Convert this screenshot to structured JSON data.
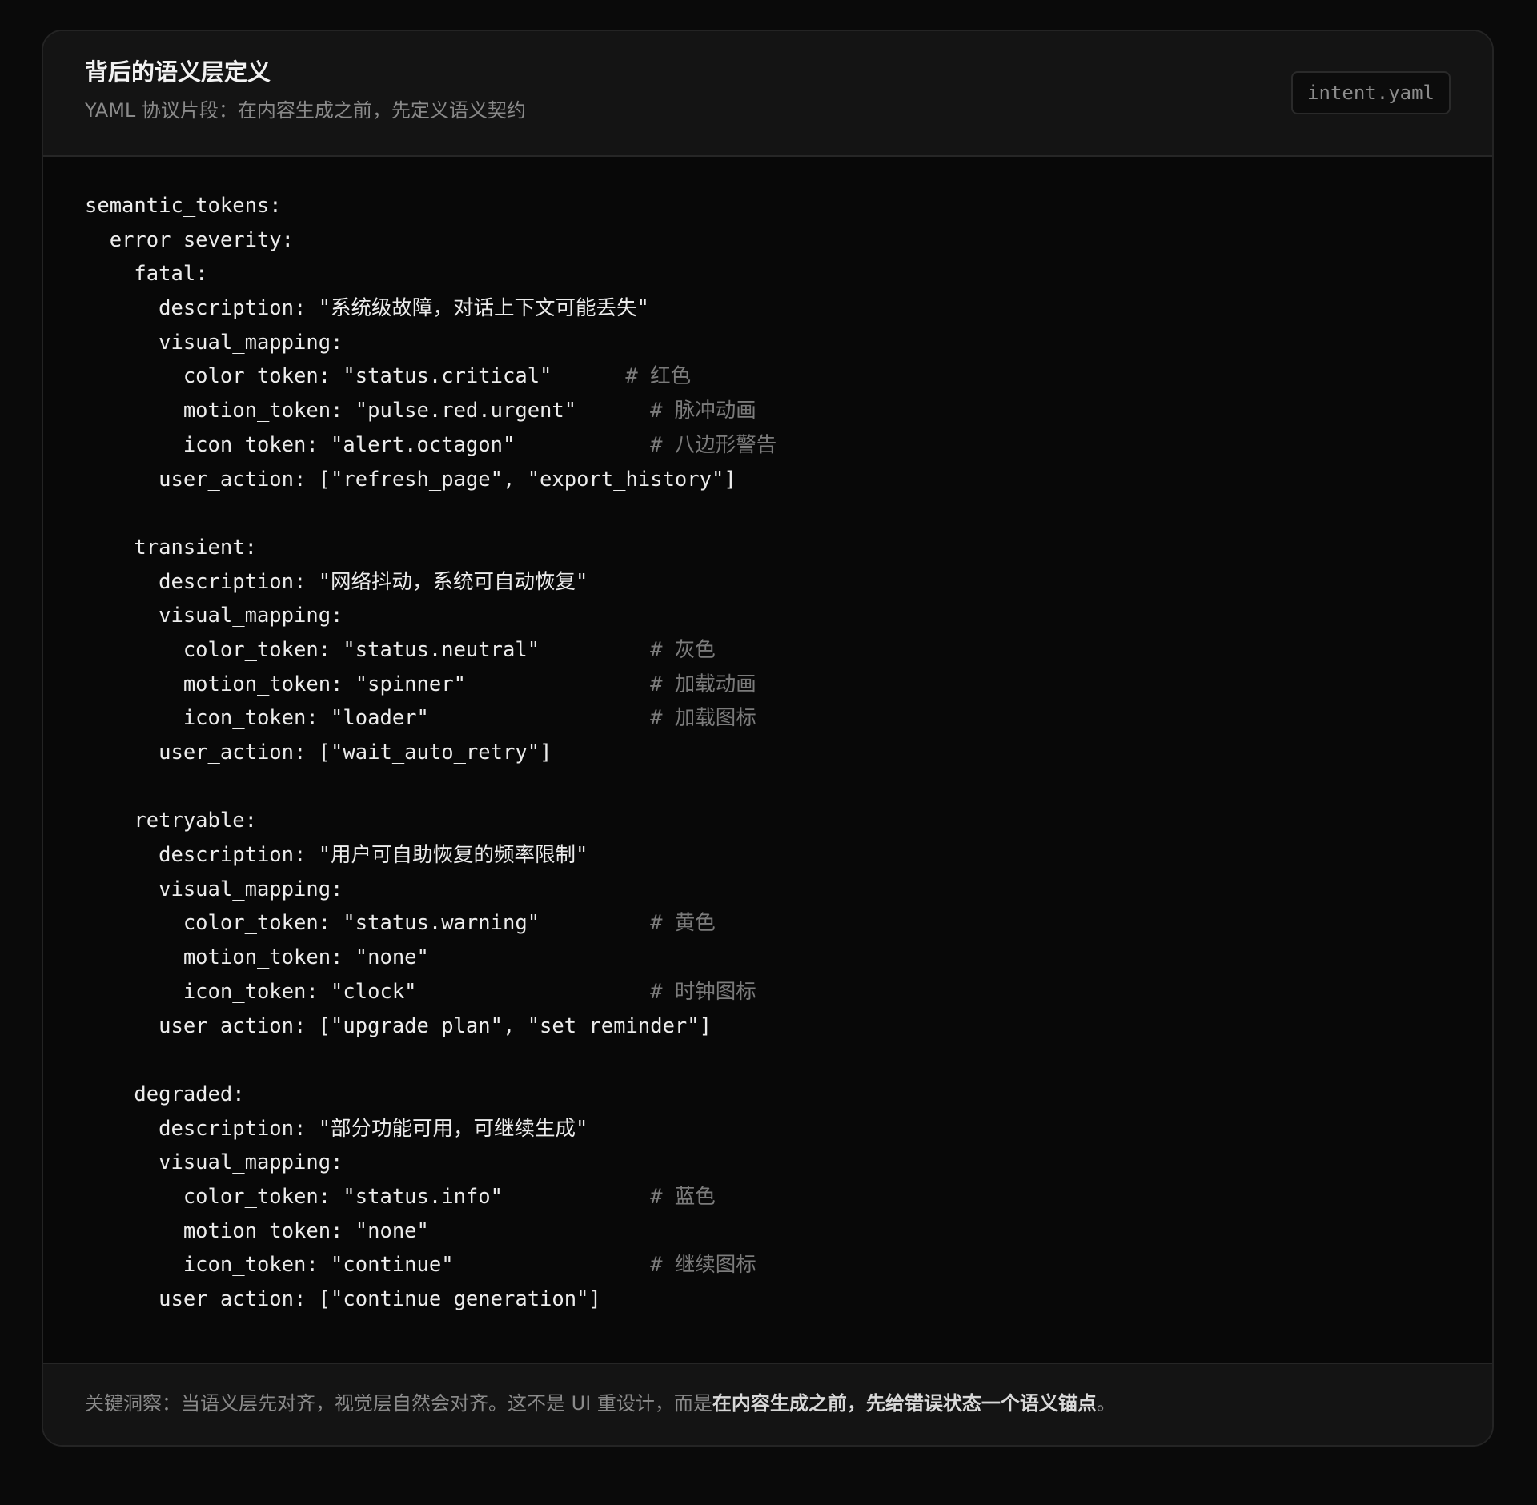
{
  "header": {
    "title": "背后的语义层定义",
    "subtitle": "YAML 协议片段：在内容生成之前，先定义语义契约",
    "file_name": "intent.yaml"
  },
  "code": {
    "lines": [
      {
        "indent": 0,
        "text": "semantic_tokens:"
      },
      {
        "indent": 1,
        "text": "error_severity:"
      },
      {
        "indent": 2,
        "text": "fatal:"
      },
      {
        "indent": 3,
        "text": "description: \"系统级故障，对话上下文可能丢失\""
      },
      {
        "indent": 3,
        "text": "visual_mapping:"
      },
      {
        "indent": 4,
        "text": "color_token: \"status.critical\"",
        "comment_col": 44,
        "comment": "# 红色"
      },
      {
        "indent": 4,
        "text": "motion_token: \"pulse.red.urgent\"",
        "comment_col": 46,
        "comment": "# 脉冲动画"
      },
      {
        "indent": 4,
        "text": "icon_token: \"alert.octagon\"",
        "comment_col": 46,
        "comment": "# 八边形警告"
      },
      {
        "indent": 3,
        "text": "user_action: [\"refresh_page\", \"export_history\"]"
      },
      {
        "indent": 0,
        "text": ""
      },
      {
        "indent": 2,
        "text": "transient:"
      },
      {
        "indent": 3,
        "text": "description: \"网络抖动，系统可自动恢复\""
      },
      {
        "indent": 3,
        "text": "visual_mapping:"
      },
      {
        "indent": 4,
        "text": "color_token: \"status.neutral\"",
        "comment_col": 46,
        "comment": "# 灰色"
      },
      {
        "indent": 4,
        "text": "motion_token: \"spinner\"",
        "comment_col": 46,
        "comment": "# 加载动画"
      },
      {
        "indent": 4,
        "text": "icon_token: \"loader\"",
        "comment_col": 46,
        "comment": "# 加载图标"
      },
      {
        "indent": 3,
        "text": "user_action: [\"wait_auto_retry\"]"
      },
      {
        "indent": 0,
        "text": ""
      },
      {
        "indent": 2,
        "text": "retryable:"
      },
      {
        "indent": 3,
        "text": "description: \"用户可自助恢复的频率限制\""
      },
      {
        "indent": 3,
        "text": "visual_mapping:"
      },
      {
        "indent": 4,
        "text": "color_token: \"status.warning\"",
        "comment_col": 46,
        "comment": "# 黄色"
      },
      {
        "indent": 4,
        "text": "motion_token: \"none\""
      },
      {
        "indent": 4,
        "text": "icon_token: \"clock\"",
        "comment_col": 46,
        "comment": "# 时钟图标"
      },
      {
        "indent": 3,
        "text": "user_action: [\"upgrade_plan\", \"set_reminder\"]"
      },
      {
        "indent": 0,
        "text": ""
      },
      {
        "indent": 2,
        "text": "degraded:"
      },
      {
        "indent": 3,
        "text": "description: \"部分功能可用，可继续生成\""
      },
      {
        "indent": 3,
        "text": "visual_mapping:"
      },
      {
        "indent": 4,
        "text": "color_token: \"status.info\"",
        "comment_col": 46,
        "comment": "# 蓝色"
      },
      {
        "indent": 4,
        "text": "motion_token: \"none\""
      },
      {
        "indent": 4,
        "text": "icon_token: \"continue\"",
        "comment_col": 46,
        "comment": "# 继续图标"
      },
      {
        "indent": 3,
        "text": "user_action: [\"continue_generation\"]"
      }
    ]
  },
  "footer": {
    "insight_prefix": "关键洞察：当语义层先对齐，视觉层自然会对齐。这不是 UI 重设计，而是",
    "insight_emphasis": "在内容生成之前，先给错误状态一个语义锚点",
    "insight_suffix": "。"
  }
}
